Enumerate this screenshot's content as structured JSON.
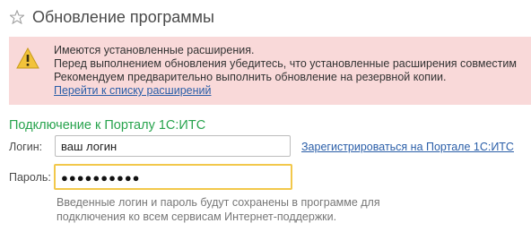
{
  "header": {
    "title": "Обновление программы",
    "star_icon": "star-icon"
  },
  "warning": {
    "icon": "warning-icon",
    "lines": [
      "Имеются установленные расширения.",
      "Перед выполнением обновления убедитесь, что установленные расширения совместим",
      "Рекомендуем предварительно выполнить обновление на резервной копии."
    ],
    "link": "Перейти к списку расширений",
    "background": "#f9d9d9"
  },
  "connection": {
    "title": "Подключение к Порталу 1С:ИТС",
    "title_color": "#27a34d",
    "login_label": "Логин:",
    "login_value": "ваш логин",
    "register_link": "Зарегистрироваться на Портале 1С:ИТС",
    "password_label": "Пароль:",
    "password_value": "●●●●●●●●●●",
    "hint_lines": [
      "Введенные логин и пароль будут сохранены в программе для",
      "подключения ко всем сервисам Интернет-поддержки."
    ]
  }
}
